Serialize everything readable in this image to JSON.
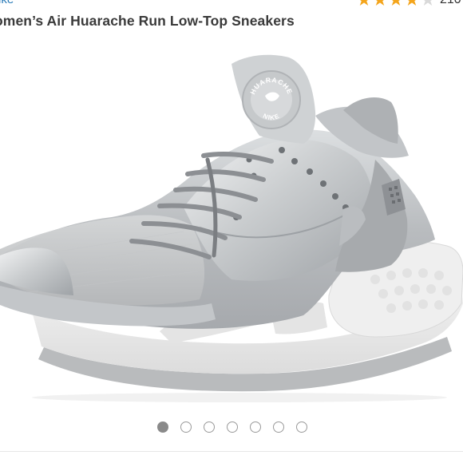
{
  "header": {
    "brand_link": "ike",
    "rating": {
      "stars_filled": 4,
      "stars_total": 5,
      "review_count": "210"
    },
    "title": "omen’s Air Huarache Run Low-Top Sneakers"
  },
  "product_image": {
    "icon": "sneaker-image",
    "heel_logo_text": "HUARACHE",
    "heel_brand_text": "NIKE"
  },
  "carousel": {
    "total_slides": 7,
    "active_index": 0
  },
  "colors": {
    "link_blue": "#2a7bb8",
    "star_gold": "#f4a51c",
    "silver": "#c8cacc",
    "sole_white": "#ececec",
    "dot_active": "#8a8a8a"
  }
}
